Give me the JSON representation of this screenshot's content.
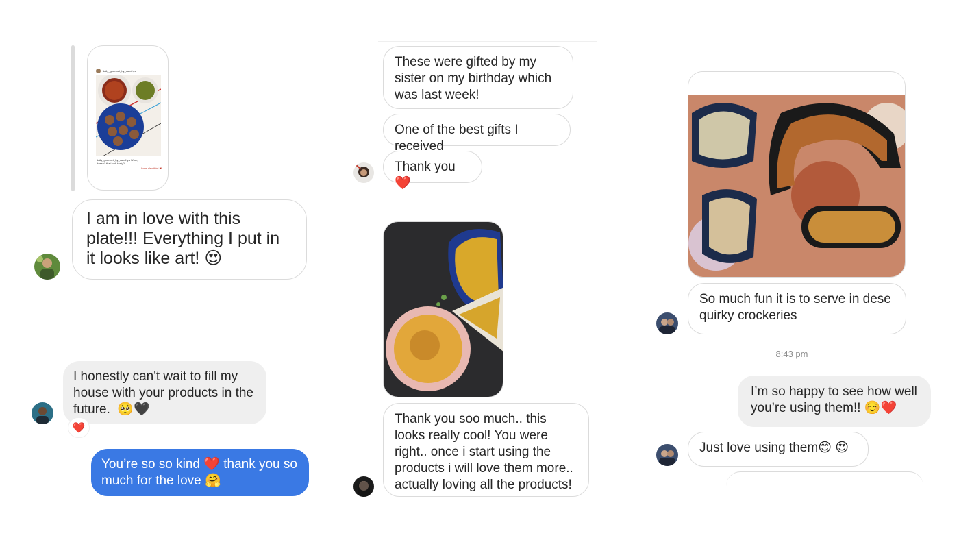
{
  "panel_left": {
    "shared_post": {
      "username": "daily_gourmet_by_sandhya",
      "caption": "daily_gourmet_by_sandhya Wow, doesn't that look tasty?",
      "action": "Love also this! ❤"
    },
    "msg_love_plate": "I am in love with this plate!!! Everything I put in it looks like art! 😍",
    "msg_cant_wait": "I honestly can't wait to fill my house with your products in the future.  🥺🖤",
    "reaction": "❤️",
    "msg_reply": "You’re so so kind ❤️ thank you so much for the love 🤗"
  },
  "panel_middle": {
    "msg_gifted": "These were gifted by my sister on my birthday which was last week!",
    "msg_best_gift": "One of the best gifts I received",
    "msg_thank_you": "Thank you ❤️",
    "msg_thank_you_much": "Thank you soo much.. this looks really cool! You were right.. once i start using the products i will love them more.. actually loving all the products!"
  },
  "panel_right": {
    "msg_fun": "So much fun it is to serve in dese quirky crockeries",
    "timestamp": "8:43 pm",
    "msg_happy": "I’m so happy to see how well you’re using them!! ☺️❤️",
    "msg_just_love": "Just love using them😊 😍"
  },
  "colors": {
    "bubble_border": "#dbdbdb",
    "grey_bubble": "#efefef",
    "blue_bubble": "#3a79e4",
    "text": "#262626",
    "timestamp": "#8e8e8e"
  }
}
